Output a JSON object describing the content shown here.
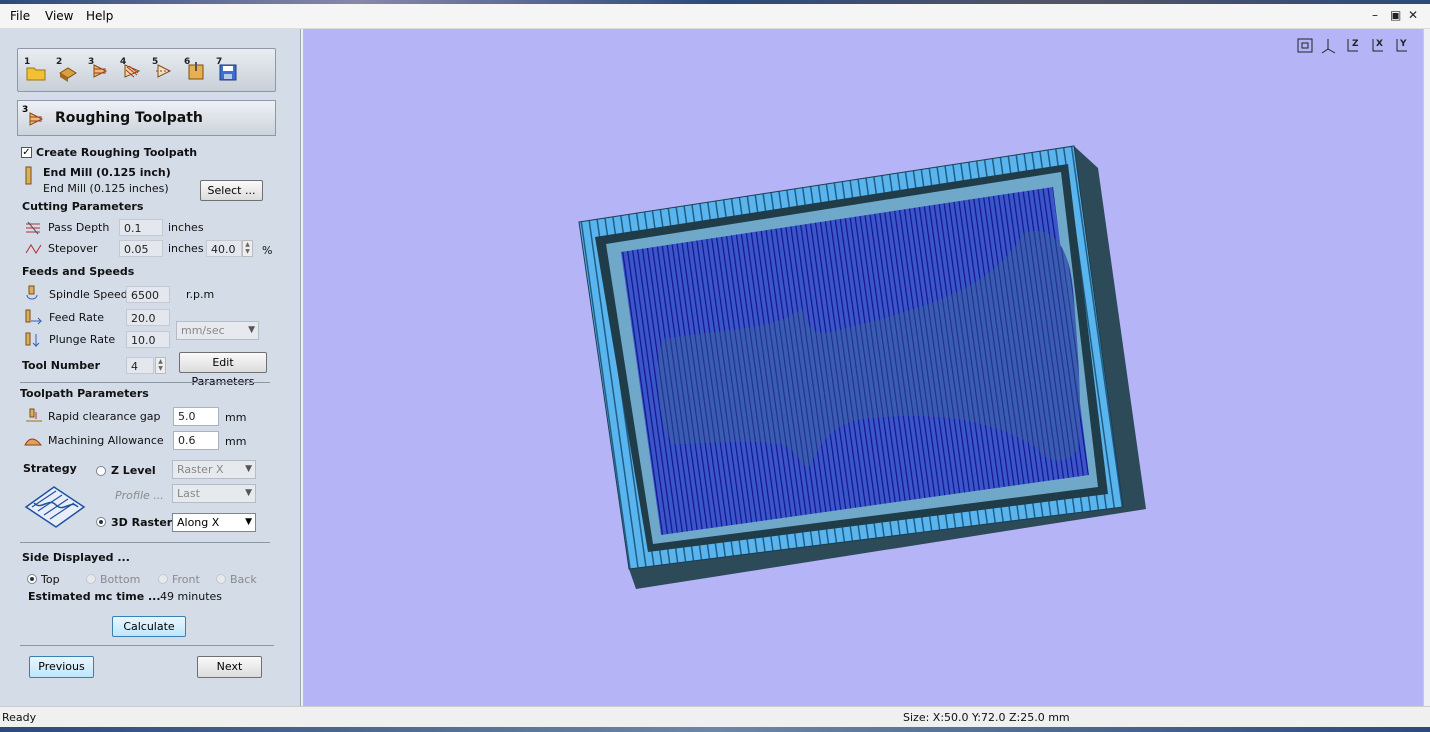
{
  "menu": {
    "file": "File",
    "view": "View",
    "help": "Help"
  },
  "window_controls": {
    "minimize": "–",
    "restore": "▣",
    "close": "✕"
  },
  "wizard": {
    "steps": [
      "1",
      "2",
      "3",
      "4",
      "5",
      "6",
      "7"
    ],
    "title": "Roughing Toolpath",
    "title_step": "3"
  },
  "tool": {
    "create_label": "Create Roughing Toolpath",
    "create_checked": true,
    "name": "End Mill (0.125 inch)",
    "subname": "End Mill (0.125 inches)",
    "select_label": "Select ..."
  },
  "cutting": {
    "heading": "Cutting Parameters",
    "pass_depth_label": "Pass Depth",
    "pass_depth_value": "0.1",
    "pass_depth_unit": "inches",
    "stepover_label": "Stepover",
    "stepover_value": "0.05",
    "stepover_unit": "inches",
    "stepover_percent": "40.0",
    "percent_sign": "%"
  },
  "feeds": {
    "heading": "Feeds and Speeds",
    "spindle_label": "Spindle Speed",
    "spindle_value": "6500",
    "spindle_unit": "r.p.m",
    "feed_label": "Feed Rate",
    "feed_value": "20.0",
    "plunge_label": "Plunge Rate",
    "plunge_value": "10.0",
    "rate_unit": "mm/sec",
    "tool_number_label": "Tool Number",
    "tool_number_value": "4",
    "edit_label": "Edit Parameters"
  },
  "toolpath": {
    "heading": "Toolpath Parameters",
    "rapid_label": "Rapid clearance gap",
    "rapid_value": "5.0",
    "rapid_unit": "mm",
    "allowance_label": "Machining Allowance",
    "allowance_value": "0.6",
    "allowance_unit": "mm"
  },
  "strategy": {
    "heading": "Strategy",
    "zlevel_label": "Z Level",
    "zlevel_combo": "Raster X",
    "profile_label": "Profile ...",
    "profile_combo": "Last",
    "raster_label": "3D Raster",
    "raster_combo": "Along X",
    "selected": "3D Raster"
  },
  "side": {
    "heading": "Side Displayed ...",
    "options": [
      "Top",
      "Bottom",
      "Front",
      "Back"
    ],
    "selected": "Top",
    "time_label": "Estimated mc time ...",
    "time_value": "49 minutes"
  },
  "buttons": {
    "calculate": "Calculate",
    "previous": "Previous",
    "next": "Next"
  },
  "viewport": {
    "background": "#b4b4f6",
    "view_icons": [
      "fit-view-icon",
      "iso-view-icon",
      "z-axis-view-icon",
      "x-axis-view-icon",
      "y-axis-view-icon"
    ],
    "axis_letters": [
      "Z",
      "X",
      "Y"
    ]
  },
  "status": {
    "left": "Ready",
    "size": "Size: X:50.0 Y:72.0 Z:25.0 mm"
  },
  "colors": {
    "panel": "#d4dce8",
    "stock_light": "#5ab4ee",
    "stock_dark": "#2c4a58",
    "toolpath": "#1a1aa8"
  }
}
